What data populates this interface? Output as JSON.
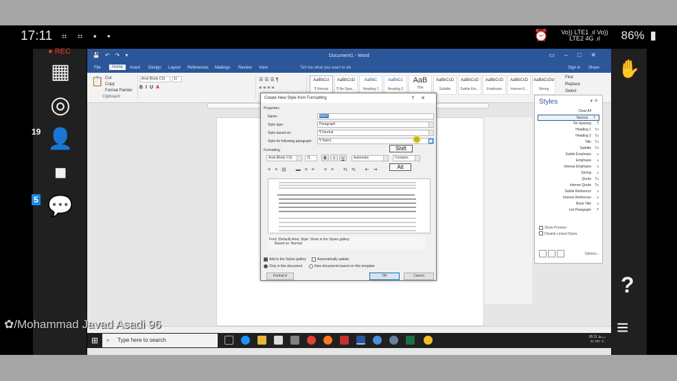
{
  "phone_status": {
    "time": "17:11",
    "network": "Vo)) LTE1 .ıl Vo)) LTE2 4G .ıl",
    "battery": "86%"
  },
  "recording": {
    "label": "REC"
  },
  "left_panel": {
    "participants_badge": "19",
    "chat_badge": "5"
  },
  "right_panel": {
    "help_label": "?"
  },
  "watermark": "/Mohammad Javad Asadi 96",
  "word": {
    "title": "Document1 - Word",
    "tabs": [
      "File",
      "Home",
      "Insert",
      "Design",
      "Layout",
      "References",
      "Mailings",
      "Review",
      "View",
      "Tell me what you want to do"
    ],
    "active_tab": "Home",
    "clipboard": {
      "cut": "Cut",
      "copy": "Copy",
      "format_painter": "Format Painter",
      "group": "Clipboard"
    },
    "font_name": "Arial (Body CS)",
    "font_size": "11",
    "styles_gallery": [
      {
        "sample": "AaBbCcI",
        "name": "¶ Normal"
      },
      {
        "sample": "AaBbCcD",
        "name": "¶ No Spac..."
      },
      {
        "sample": "AaBbC",
        "name": "Heading 1"
      },
      {
        "sample": "AaBbCc",
        "name": "Heading 2"
      },
      {
        "sample": "AaB",
        "name": "Title"
      },
      {
        "sample": "AaBbCcD",
        "name": "Subtitle"
      },
      {
        "sample": "AaBbCcD",
        "name": "Subtle Em..."
      },
      {
        "sample": "AaBbCcD",
        "name": "Emphasis"
      },
      {
        "sample": "AaBbCcD",
        "name": "Intense E..."
      },
      {
        "sample": "AaBbCcDd",
        "name": "Strong"
      }
    ],
    "editing": {
      "find": "Find",
      "replace": "Replace",
      "select": "Select"
    },
    "user": "Sign in",
    "share": "Share"
  },
  "styles_pane": {
    "title": "Styles",
    "items": [
      {
        "name": "Clear All",
        "mark": ""
      },
      {
        "name": "Normal",
        "mark": "¶"
      },
      {
        "name": "No Spacing",
        "mark": "¶"
      },
      {
        "name": "Heading 1",
        "mark": "¶a"
      },
      {
        "name": "Heading 2",
        "mark": "¶a"
      },
      {
        "name": "Title",
        "mark": "¶a"
      },
      {
        "name": "Subtitle",
        "mark": "¶a"
      },
      {
        "name": "Subtle Emphasis",
        "mark": "a"
      },
      {
        "name": "Emphasis",
        "mark": "a"
      },
      {
        "name": "Intense Emphasis",
        "mark": "a"
      },
      {
        "name": "Strong",
        "mark": "a"
      },
      {
        "name": "Quote",
        "mark": "¶a"
      },
      {
        "name": "Intense Quote",
        "mark": "¶a"
      },
      {
        "name": "Subtle Reference",
        "mark": "a"
      },
      {
        "name": "Intense Reference",
        "mark": "a"
      },
      {
        "name": "Book Title",
        "mark": "a"
      },
      {
        "name": "List Paragraph",
        "mark": "¶"
      }
    ],
    "selected": "Normal",
    "show_preview": "Show Preview",
    "disable_linked": "Disable Linked Styles",
    "options": "Options..."
  },
  "dialog": {
    "title": "Create New Style from Formatting",
    "properties_label": "Properties",
    "name_label": "Name:",
    "name_value": "Style1",
    "style_type_label": "Style type:",
    "style_type_value": "Paragraph",
    "based_on_label": "Style based on:",
    "based_on_value": "¶ Normal",
    "following_label": "Style for following paragraph:",
    "following_value": "¶ Style1",
    "formatting_label": "Formatting",
    "font_value": "Arial (Body CS)",
    "size_value": "11",
    "color_value": "Automatic",
    "script_value": "Complex",
    "bold": "B",
    "italic": "I",
    "underline": "U",
    "description_line1": "Font: (Default) Arial, Style: Show in the Styles gallery",
    "description_line2": "Based on: Normal",
    "add_gallery": "Add to the Styles gallery",
    "auto_update": "Automatically update",
    "only_doc": "Only in this document",
    "new_docs": "New documents based on this template",
    "format_btn": "Format ▾",
    "ok_btn": "OK",
    "cancel_btn": "Cancel"
  },
  "key_overlays": {
    "shift": "Shift",
    "alt": "Alt"
  },
  "taskbar": {
    "search_placeholder": "Type here to search",
    "time": "05:11 ب.ظ",
    "date": "۰۴/۰۳/۲۰۲۰"
  }
}
